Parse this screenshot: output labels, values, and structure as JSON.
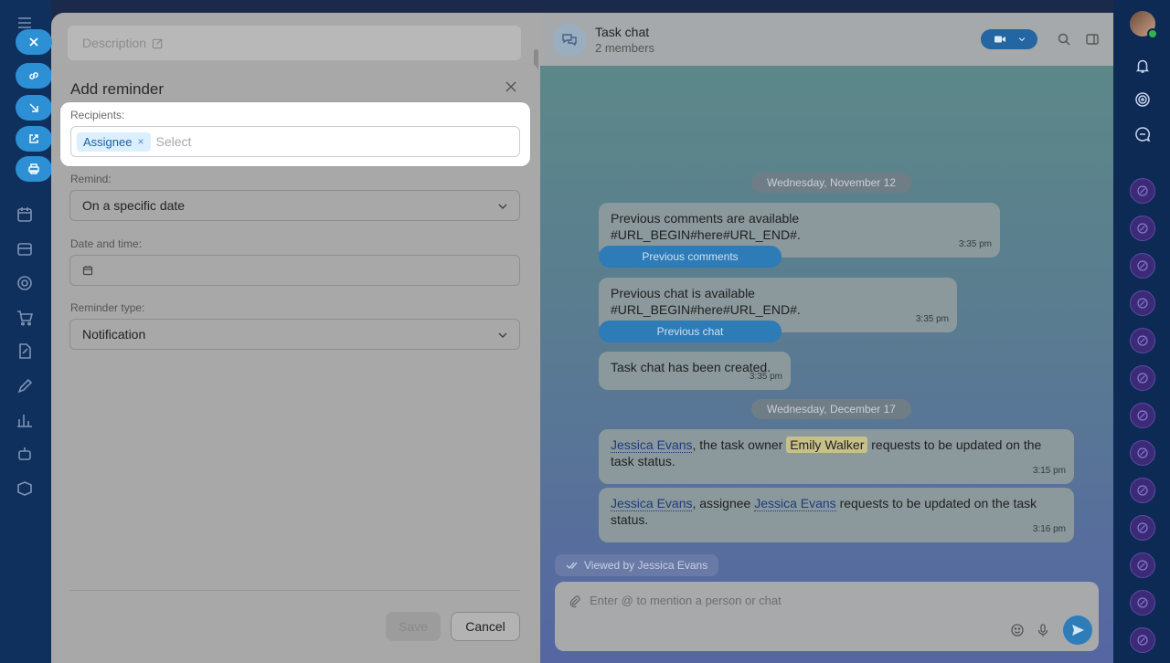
{
  "form": {
    "description_placeholder": "Description"
  },
  "dialog": {
    "title": "Add reminder",
    "recipients_label": "Recipients:",
    "recipient_chip": "Assignee",
    "recipient_chip_remove": "×",
    "recipients_placeholder": "Select",
    "remind_label": "Remind:",
    "remind_value": "On a specific date",
    "datetime_label": "Date and time:",
    "datetime_value": "",
    "type_label": "Reminder type:",
    "type_value": "Notification",
    "save_label": "Save",
    "cancel_label": "Cancel"
  },
  "chat": {
    "title": "Task chat",
    "subtitle": "2 members",
    "dates": [
      "Wednesday, November 12",
      "Wednesday, December 17"
    ],
    "messages": [
      {
        "text": "Previous comments are available #URL_BEGIN#here#URL_END#.",
        "time": "3:35 pm"
      },
      {
        "button": "Previous comments"
      },
      {
        "text": "Previous chat is available #URL_BEGIN#here#URL_END#.",
        "time": "3:35 pm"
      },
      {
        "button": "Previous chat"
      },
      {
        "text": "Task chat has been created.",
        "time": "3:35 pm"
      }
    ],
    "status_msg_1": {
      "mention_1": "Jessica Evans",
      "text_1": ", the task owner ",
      "owner": "Emily Walker",
      "text_2": " requests to be updated on the task status.",
      "time": "3:15 pm"
    },
    "status_msg_2": {
      "mention_1": "Jessica Evans",
      "text_1": ", assignee ",
      "mention_2": "Jessica Evans",
      "text_2": " requests to be updated on the task status.",
      "time": "3:16 pm"
    },
    "viewed_by": "Viewed by Jessica Evans",
    "composer_placeholder": "Enter @ to mention a person or chat"
  },
  "icons": {
    "left_rail": [
      "menu-icon",
      "link-icon",
      "arrow-down-right-icon",
      "external-link-icon",
      "print-icon",
      "filter-icon",
      "calendar-icon",
      "drive-icon",
      "target-icon",
      "cart-icon",
      "document-edit-icon",
      "pen-icon",
      "chart-icon",
      "robot-icon",
      "box-icon"
    ],
    "right_rail": [
      "bell-icon",
      "spiral-icon",
      "chat-bubble-icon"
    ]
  },
  "colors": {
    "accent": "#2d8fd4",
    "highlight_bg": "#ffffff",
    "chip_bg": "#dcefff",
    "chip_text": "#1d5fa6"
  }
}
